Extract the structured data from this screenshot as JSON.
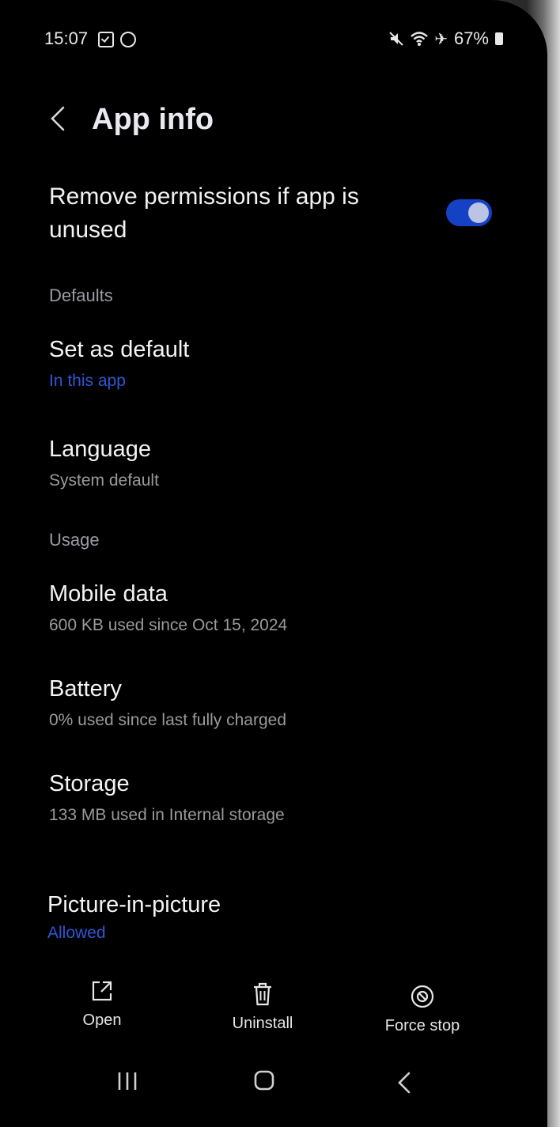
{
  "status_bar": {
    "time": "15:07",
    "battery": "67%"
  },
  "header": {
    "title": "App info"
  },
  "toggle_row": {
    "label": "Remove permissions if app is unused",
    "enabled": true
  },
  "defaults": {
    "section_label": "Defaults",
    "set_as_default": {
      "title": "Set as default",
      "subtitle": "In this app"
    },
    "language": {
      "title": "Language",
      "subtitle": "System default"
    }
  },
  "usage": {
    "section_label": "Usage",
    "mobile_data": {
      "title": "Mobile data",
      "subtitle": "600 KB used since Oct 15, 2024"
    },
    "battery": {
      "title": "Battery",
      "subtitle": "0% used since last fully charged"
    },
    "storage": {
      "title": "Storage",
      "subtitle": "133 MB used in Internal storage"
    }
  },
  "pip": {
    "title": "Picture-in-picture",
    "subtitle": "Allowed"
  },
  "actions": {
    "open": "Open",
    "uninstall": "Uninstall",
    "force_stop": "Force stop"
  },
  "colors": {
    "accent": "#2f56d6",
    "switch_on": "#1541c5",
    "background": "#000000"
  }
}
